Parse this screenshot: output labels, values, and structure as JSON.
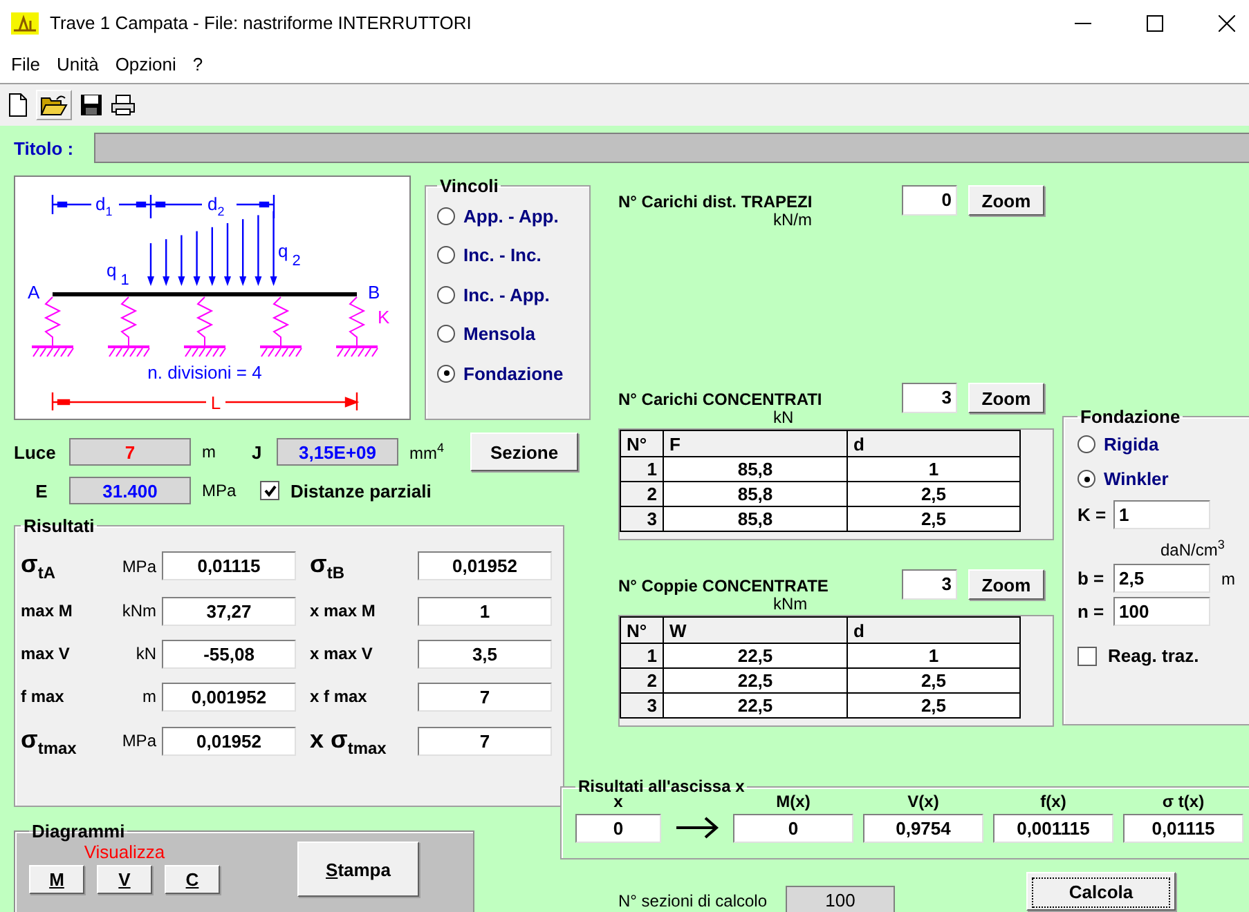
{
  "window": {
    "title": "Trave 1 Campata - File: nastriforme INTERRUTTORI"
  },
  "menu": [
    "File",
    "Unità",
    "Opzioni",
    "?"
  ],
  "titolo": {
    "label": "Titolo :"
  },
  "diagram": {
    "span_1": {
      "symbol": "d",
      "index": "1"
    },
    "span_2": {
      "symbol": "d",
      "index": "2"
    },
    "load_1": {
      "symbol": "q",
      "index": "1"
    },
    "load_2": {
      "symbol": "q",
      "index": "2"
    },
    "end_a": "A",
    "end_b": "B",
    "spring": "K",
    "divisions": "n. divisioni = 4",
    "length": "L"
  },
  "vincoli": {
    "title": "Vincoli",
    "options": [
      {
        "label": "App. - App.",
        "selected": false
      },
      {
        "label": "Inc. - Inc.",
        "selected": false
      },
      {
        "label": "Inc. - App.",
        "selected": false
      },
      {
        "label": "Mensola",
        "selected": false
      },
      {
        "label": "Fondazione",
        "selected": true
      }
    ]
  },
  "luce": {
    "label": "Luce",
    "value": "7",
    "unit": "m"
  },
  "inertia": {
    "label": "J",
    "value": "3,15E+09",
    "unit": "mm$^{4}$"
  },
  "section_button": "Sezione",
  "modulus": {
    "label": "E",
    "value": "31.400",
    "unit": "MPa"
  },
  "partial_distances": {
    "label": "Distanze parziali",
    "checked": true
  },
  "risultati": {
    "title": "Risultati",
    "rows": [
      {
        "left": {
          "kind": "stress",
          "label": "σ$_{tA}$",
          "unit": "MPa",
          "value": "0,01115"
        },
        "right": {
          "kind": "stress",
          "label": "σ$_{tB}$",
          "value": "0,01952"
        }
      },
      {
        "left": {
          "kind": "plain",
          "label": "max M",
          "unit": "kNm",
          "value": "37,27"
        },
        "right": {
          "kind": "plain",
          "label": "x max M",
          "value": "1"
        }
      },
      {
        "left": {
          "kind": "plain",
          "label": "max V",
          "unit": "kN",
          "value": "-55,08"
        },
        "right": {
          "kind": "plain",
          "label": "x max V",
          "value": "3,5"
        }
      },
      {
        "left": {
          "kind": "plain",
          "label": "f max",
          "unit": "m",
          "value": "0,001952"
        },
        "right": {
          "kind": "plain",
          "label": "x f max",
          "value": "7"
        }
      },
      {
        "left": {
          "kind": "stress",
          "label": "σ$_{tmax}$",
          "unit": "MPa",
          "value": "0,01952"
        },
        "right": {
          "kind": "stress",
          "label": "x σ$_{tmax}$",
          "value": "7"
        }
      }
    ]
  },
  "diagrammi": {
    "title": "Diagrammi",
    "caption": "Visualizza",
    "buttons": [
      "M",
      "V",
      "C"
    ],
    "print": "Stampa"
  },
  "trapezi": {
    "label": "N° Carichi dist. TRAPEZI",
    "unit": "kN/m",
    "count": "0",
    "zoom": "Zoom"
  },
  "concentrati": {
    "label": "N° Carichi CONCENTRATI",
    "unit": "kN",
    "count": "3",
    "zoom": "Zoom",
    "columns": [
      "N°",
      "F",
      "d"
    ],
    "rows": [
      [
        "1",
        "85,8",
        "1"
      ],
      [
        "2",
        "85,8",
        "2,5"
      ],
      [
        "3",
        "85,8",
        "2,5"
      ]
    ]
  },
  "coppie": {
    "label": "N° Coppie CONCENTRATE",
    "unit": "kNm",
    "count": "3",
    "zoom": "Zoom",
    "columns": [
      "N°",
      "W",
      "d"
    ],
    "rows": [
      [
        "1",
        "22,5",
        "1"
      ],
      [
        "2",
        "22,5",
        "2,5"
      ],
      [
        "3",
        "22,5",
        "2,5"
      ]
    ]
  },
  "fondazione": {
    "title": "Fondazione",
    "options": [
      {
        "label": "Rigida",
        "selected": false
      },
      {
        "label": "Winkler",
        "selected": true
      }
    ],
    "k": {
      "label": "K =",
      "value": "1"
    },
    "k_unit": "daN/cm$^{3}$",
    "b": {
      "label": "b =",
      "value": "2,5",
      "unit": "m"
    },
    "n": {
      "label": "n =",
      "value": "100"
    },
    "tension_reaction": {
      "label": "Reag. traz.",
      "checked": false
    }
  },
  "ascissa": {
    "title": "Risultati all'ascissa x",
    "columns": [
      "x",
      "M(x)",
      "V(x)",
      "f(x)",
      "σ t(x)"
    ],
    "values": [
      "0",
      "0",
      "0,9754",
      "0,001115",
      "0,01115"
    ]
  },
  "sections": {
    "label": "N° sezioni di calcolo",
    "value": "100"
  },
  "calculate_button": "Calcola"
}
